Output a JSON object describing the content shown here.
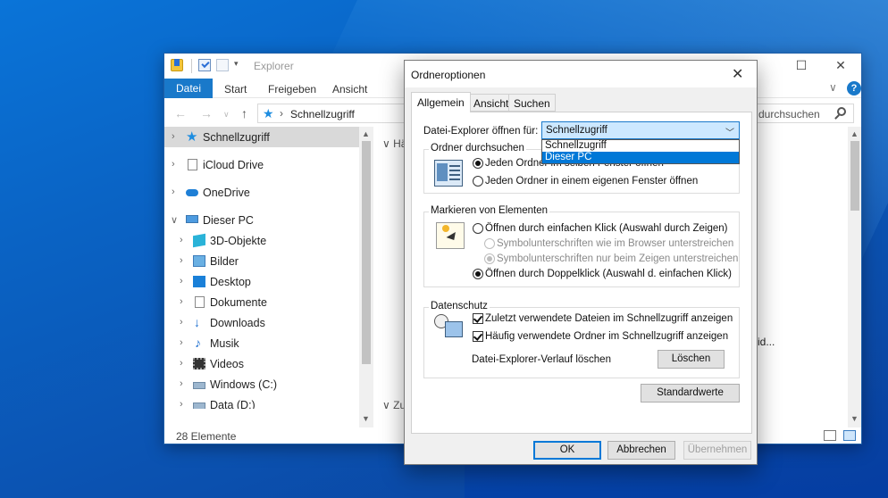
{
  "explorer": {
    "title": "Explorer",
    "ribbon_tabs": [
      "Datei",
      "Start",
      "Freigeben",
      "Ansicht"
    ],
    "address": "Schnellzugriff",
    "search_placeholder": "durchsuchen",
    "nav_items": [
      {
        "label": "Schnellzugriff",
        "icon": "star-icon",
        "selected": true,
        "expanded": false
      },
      {
        "label": "iCloud Drive",
        "icon": "file-icon",
        "selected": false,
        "expanded": false
      },
      {
        "label": "OneDrive",
        "icon": "cloud-icon",
        "selected": false,
        "expanded": false
      },
      {
        "label": "Dieser PC",
        "icon": "computer-icon",
        "selected": false,
        "expanded": true
      },
      {
        "label": "3D-Objekte",
        "icon": "cube-icon"
      },
      {
        "label": "Bilder",
        "icon": "pictures-icon"
      },
      {
        "label": "Desktop",
        "icon": "desktop-icon"
      },
      {
        "label": "Dokumente",
        "icon": "document-icon"
      },
      {
        "label": "Downloads",
        "icon": "download-icon"
      },
      {
        "label": "Musik",
        "icon": "music-icon"
      },
      {
        "label": "Videos",
        "icon": "video-icon"
      },
      {
        "label": "Windows (C:)",
        "icon": "drive-icon"
      },
      {
        "label": "Data (D:)",
        "icon": "drive-icon"
      }
    ],
    "content_partial": {
      "group1": "Hä",
      "group2": "Zu",
      "tail": "id..."
    },
    "status": "28 Elemente"
  },
  "dialog": {
    "title": "Ordneroptionen",
    "tabs": [
      "Allgemein",
      "Ansicht",
      "Suchen"
    ],
    "open_for_label": "Datei-Explorer öffnen für:",
    "open_for_value": "Schnellzugriff",
    "open_for_options": [
      "Schnellzugriff",
      "Dieser PC"
    ],
    "browse_group": {
      "title": "Ordner durchsuchen",
      "opt_same": "Jeden Ordner im selben Fenster öffnen",
      "opt_own": "Jeden Ordner in einem eigenen Fenster öffnen"
    },
    "click_group": {
      "title": "Markieren von Elementen",
      "opt_single": "Öffnen durch einfachen Klick (Auswahl durch Zeigen)",
      "sub_browser": "Symbolunterschriften wie im Browser unterstreichen",
      "sub_hover": "Symbolunterschriften nur beim Zeigen unterstreichen",
      "opt_double": "Öffnen durch Doppelklick (Auswahl d. einfachen Klick)"
    },
    "privacy_group": {
      "title": "Datenschutz",
      "chk_recent": "Zuletzt verwendete Dateien im Schnellzugriff anzeigen",
      "chk_frequent": "Häufig verwendete Ordner im Schnellzugriff anzeigen",
      "clear_label": "Datei-Explorer-Verlauf löschen",
      "clear_button": "Löschen"
    },
    "defaults_button": "Standardwerte",
    "ok": "OK",
    "cancel": "Abbrechen",
    "apply": "Übernehmen"
  }
}
